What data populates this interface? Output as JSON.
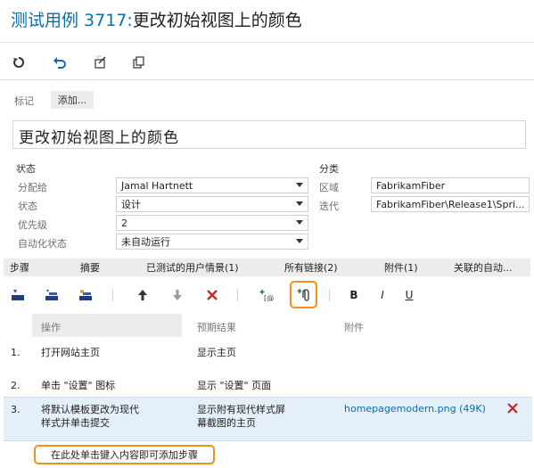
{
  "header": {
    "title_prefix": "测试用例 3717:",
    "title_text": "更改初始视图上的颜色"
  },
  "toolbar": {
    "icons": [
      "refresh-icon",
      "undo-icon",
      "edit-template-icon",
      "copy-icon"
    ]
  },
  "tags": {
    "label": "标记",
    "add_label": "添加..."
  },
  "summary": "更改初始视图上的颜色",
  "status_section": {
    "heading": "状态",
    "fields": [
      {
        "label": "分配给",
        "value": "Jamal Hartnett"
      },
      {
        "label": "状态",
        "value": "设计"
      },
      {
        "label": "优先级",
        "value": "2"
      },
      {
        "label": "自动化状态",
        "value": "未自动运行"
      }
    ]
  },
  "classification_section": {
    "heading": "分类",
    "fields": [
      {
        "label": "区域",
        "value": "FabrikamFiber"
      },
      {
        "label": "迭代",
        "value": "FabrikamFiber\\Release1\\Spri..."
      }
    ]
  },
  "tabs": [
    "步骤",
    "摘要",
    "已测试的用户情景(1)",
    "所有链接(2)",
    "附件(1)",
    "关联的自动..."
  ],
  "steps_toolbar": {
    "icons": [
      "insert-step-icon",
      "insert-shared-steps-icon",
      "create-shared-steps-icon",
      "move-up-icon",
      "move-down-icon",
      "delete-step-icon",
      "insert-parameter-icon",
      "add-attachment-icon",
      "bold-icon",
      "italic-icon",
      "underline-icon"
    ],
    "bold_label": "B",
    "italic_label": "I",
    "underline_label": "U",
    "highlight_color": "#f0901e"
  },
  "steps_grid": {
    "headers": [
      "操作",
      "预期结果",
      "附件"
    ],
    "rows": [
      {
        "num": "1.",
        "action": "打开网站主页",
        "expected": "显示主页",
        "attachment": ""
      },
      {
        "num": "2.",
        "action": "单击 \"设置\" 图标",
        "expected": "显示 \"设置\" 页面",
        "attachment": ""
      },
      {
        "num": "3.",
        "action_line1": "将默认模板更改为现代",
        "action_line2": "样式并单击提交",
        "expected_line1": "显示附有现代样式屏",
        "expected_line2": "幕截图的主页",
        "attachment": "homepagemodern.png (49K)"
      }
    ],
    "add_step_hint": "在此处单击键入内容即可添加步骤"
  }
}
